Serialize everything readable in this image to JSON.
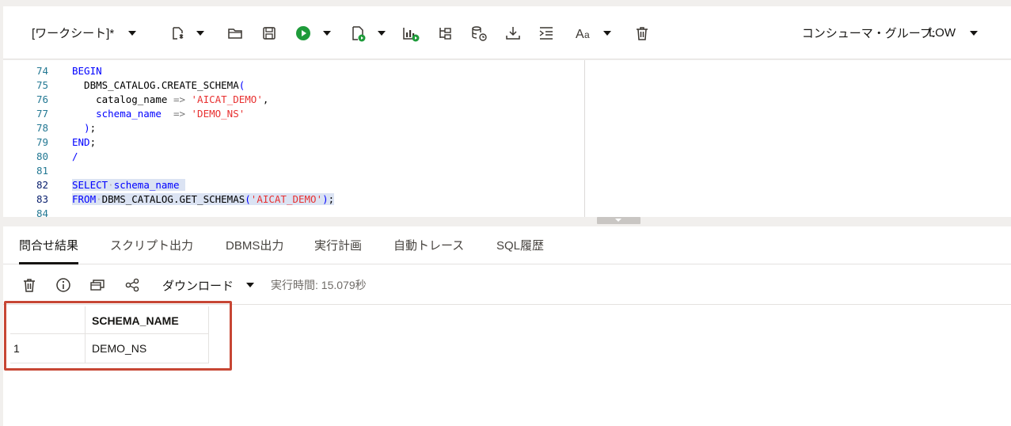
{
  "toolbar": {
    "worksheet_title": "[ワークシート]*",
    "consumer_group_label": "コンシューマ・グループ:",
    "consumer_group_value": "LOW"
  },
  "editor": {
    "lines": [
      {
        "num": "74",
        "segments": [
          {
            "t": "BEGIN",
            "c": "kw"
          }
        ]
      },
      {
        "num": "75",
        "segments": [
          {
            "t": "  DBMS_CATALOG.CREATE_SCHEMA",
            "c": ""
          },
          {
            "t": "(",
            "c": "kw"
          }
        ]
      },
      {
        "num": "76",
        "segments": [
          {
            "t": "    catalog_name ",
            "c": ""
          },
          {
            "t": "=>",
            "c": "op"
          },
          {
            "t": " ",
            "c": ""
          },
          {
            "t": "'AICAT_DEMO'",
            "c": "str"
          },
          {
            "t": ",",
            "c": ""
          }
        ]
      },
      {
        "num": "77",
        "segments": [
          {
            "t": "    schema_name  ",
            "c": "kw"
          },
          {
            "t": "=>",
            "c": "op"
          },
          {
            "t": " ",
            "c": ""
          },
          {
            "t": "'DEMO_NS'",
            "c": "str"
          }
        ]
      },
      {
        "num": "78",
        "segments": [
          {
            "t": "  ",
            "c": ""
          },
          {
            "t": ")",
            "c": "kw"
          },
          {
            "t": ";",
            "c": ""
          }
        ]
      },
      {
        "num": "79",
        "segments": [
          {
            "t": "END",
            "c": "kw"
          },
          {
            "t": ";",
            "c": ""
          }
        ]
      },
      {
        "num": "80",
        "segments": [
          {
            "t": "/",
            "c": "kw"
          }
        ]
      },
      {
        "num": "81",
        "segments": []
      },
      {
        "num": "82",
        "segments": [
          {
            "t": "SELECT",
            "c": "kw sel"
          },
          {
            "t": "·",
            "c": "dot sel"
          },
          {
            "t": "schema_name",
            "c": "kw sel"
          },
          {
            "t": " ",
            "c": "sel"
          }
        ]
      },
      {
        "num": "83",
        "segments": [
          {
            "t": "FROM",
            "c": "kw sel"
          },
          {
            "t": "·",
            "c": "dot sel"
          },
          {
            "t": "DBMS_CATALOG.GET_SCHEMAS",
            "c": "sel"
          },
          {
            "t": "(",
            "c": "kw sel"
          },
          {
            "t": "'AICAT_DEMO'",
            "c": "str sel"
          },
          {
            "t": ")",
            "c": "kw sel"
          },
          {
            "t": ";",
            "c": "sel"
          }
        ]
      },
      {
        "num": "84",
        "segments": []
      }
    ]
  },
  "tabs": [
    "問合せ結果",
    "スクリプト出力",
    "DBMS出力",
    "実行計画",
    "自動トレース",
    "SQL履歴"
  ],
  "results_toolbar": {
    "download_label": "ダウンロード",
    "exec_time": "実行時間: 15.079秒"
  },
  "results": {
    "columns": [
      "SCHEMA_NAME"
    ],
    "rows": [
      {
        "num": "1",
        "values": [
          "DEMO_NS"
        ]
      }
    ]
  },
  "colors": {
    "run_green": "#1e9b3a",
    "highlight_red": "#c74634",
    "keyword_blue": "#0000ff",
    "string_red": "#e83131"
  },
  "icons": [
    "new-worksheet-icon",
    "folder-open-icon",
    "save-icon",
    "run-statement-icon",
    "run-script-icon",
    "explain-plan-icon",
    "autotrace-icon",
    "sql-history-icon",
    "download-icon",
    "format-icon",
    "font-size-icon",
    "clear-icon",
    "delete-results-icon",
    "info-icon",
    "view-icon",
    "share-icon"
  ]
}
